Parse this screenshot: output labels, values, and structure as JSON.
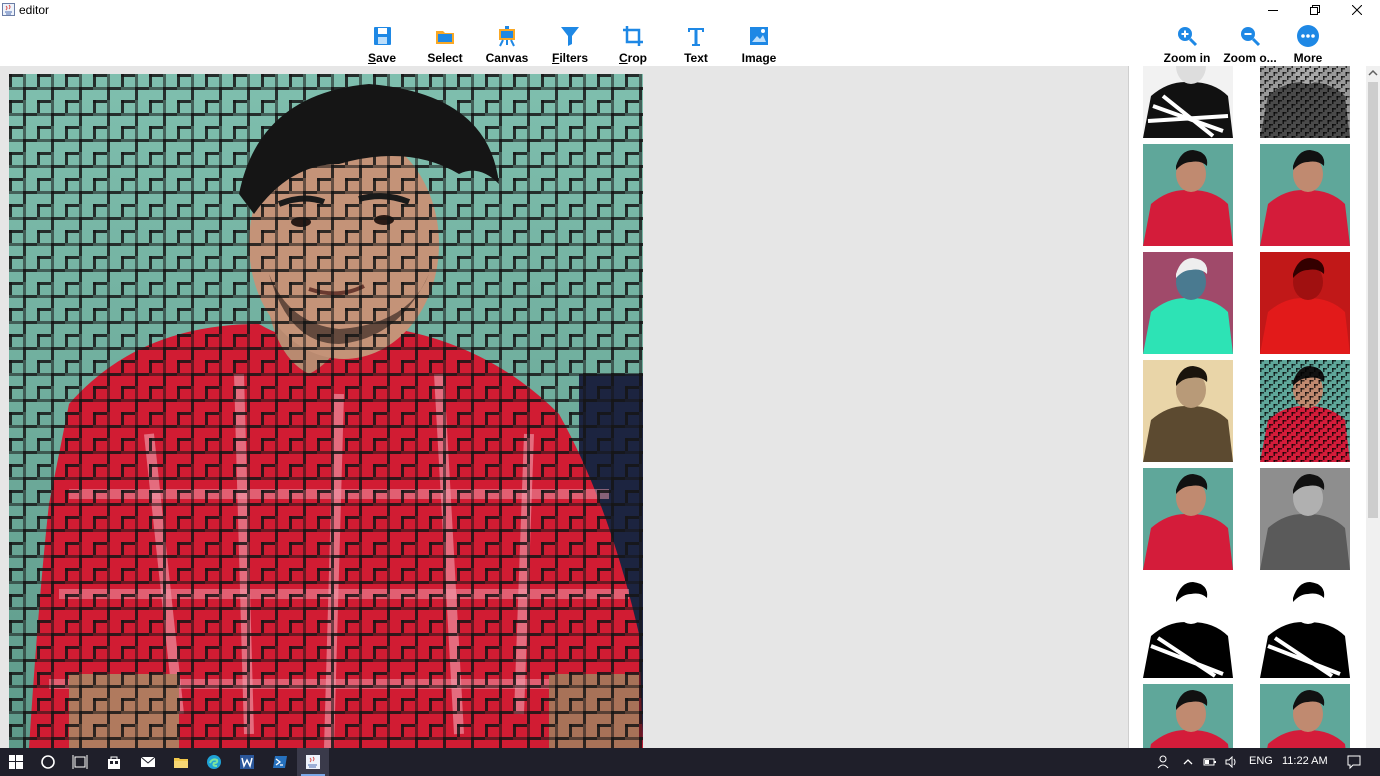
{
  "window": {
    "title": "editor"
  },
  "toolbar": {
    "items": [
      {
        "label": "Save",
        "mnemonic": "S",
        "rest": "ave",
        "icon": "save-icon"
      },
      {
        "label": "Select",
        "icon": "folder-icon"
      },
      {
        "label": "Canvas",
        "icon": "easel-icon"
      },
      {
        "label": "Filters",
        "mnemonic": "F",
        "rest": "ilters",
        "icon": "filter-icon"
      },
      {
        "label": "Crop",
        "mnemonic": "C",
        "rest": "rop",
        "icon": "crop-icon"
      },
      {
        "label": "Text",
        "icon": "text-icon"
      },
      {
        "label": "Image",
        "icon": "image-icon"
      },
      {
        "label": "Zoom in",
        "icon": "zoom-in-icon"
      },
      {
        "label": "Zoom o...",
        "icon": "zoom-out-icon"
      },
      {
        "label": "More",
        "icon": "more-icon"
      }
    ]
  },
  "colors": {
    "accent": "#1e88e5",
    "workspace_bg": "#e6e6e6",
    "taskbar_bg": "#1f1f2a"
  },
  "taskbar": {
    "language": "ENG",
    "time": "11:22 AM"
  }
}
